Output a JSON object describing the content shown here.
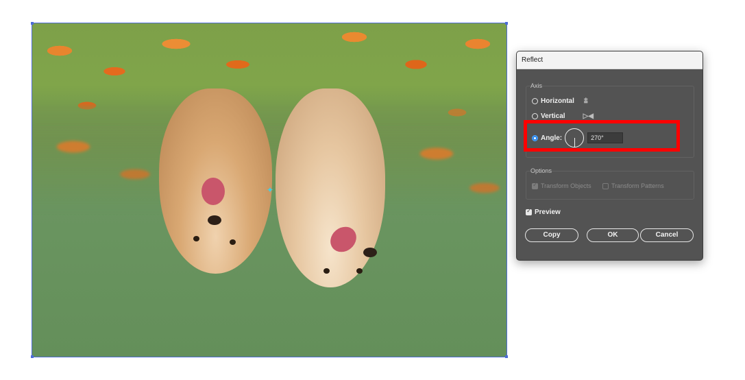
{
  "dialog": {
    "title": "Reflect",
    "axis": {
      "group_label": "Axis",
      "horizontal_label": "Horizontal",
      "vertical_label": "Vertical",
      "angle_label": "Angle:",
      "angle_value": "270°",
      "selected": "angle"
    },
    "options": {
      "group_label": "Options",
      "transform_objects_label": "Transform Objects",
      "transform_objects_checked": true,
      "transform_patterns_label": "Transform Patterns",
      "transform_patterns_checked": false
    },
    "preview_label": "Preview",
    "preview_checked": true,
    "buttons": {
      "copy": "Copy",
      "ok": "OK",
      "cancel": "Cancel"
    }
  },
  "colors": {
    "highlight": "#ff0000",
    "accent": "#2f88e8",
    "dialog_bg": "#535353"
  }
}
